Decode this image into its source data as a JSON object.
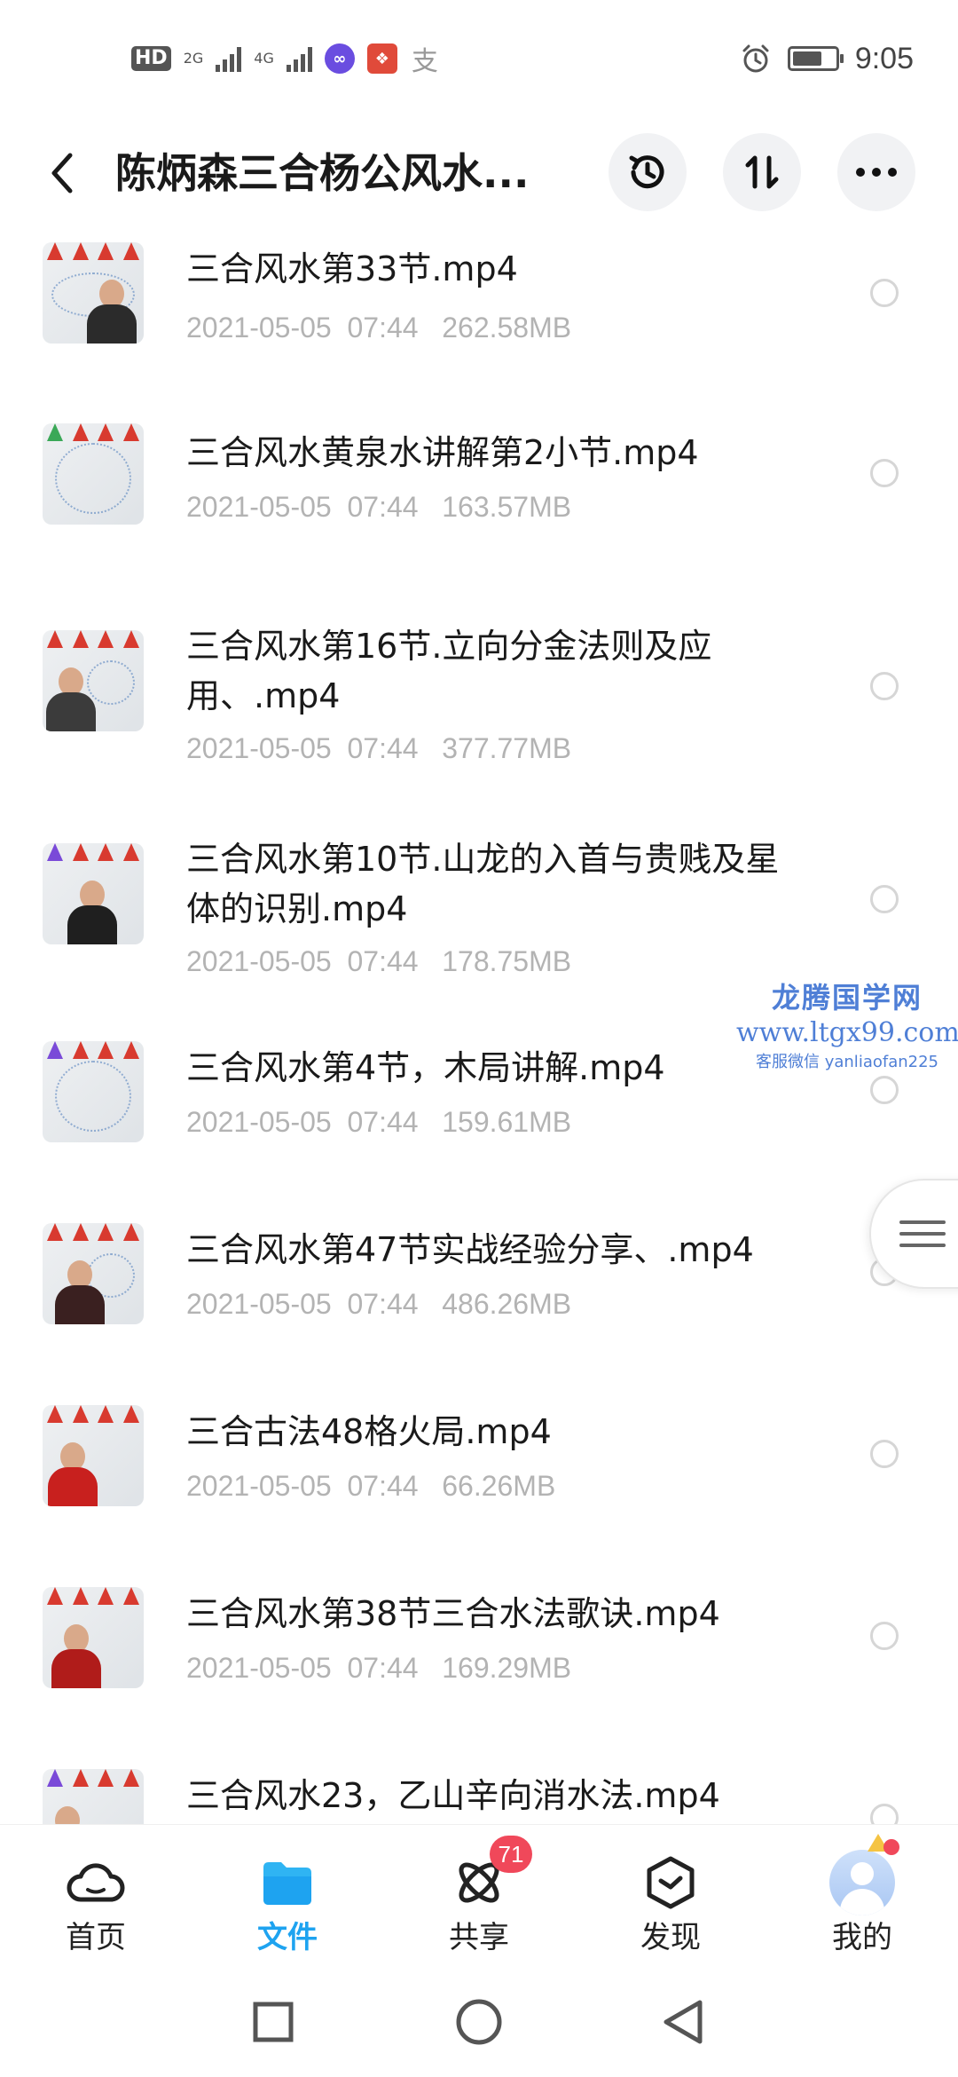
{
  "status_bar": {
    "hd_label": "HD",
    "network_labels": [
      "2G",
      "4G"
    ],
    "apps": [
      {
        "icon": "infinity-app-icon",
        "color": "#6a4de0"
      },
      {
        "icon": "red-app-icon",
        "color": "#e04a3a"
      },
      {
        "icon": "alipay-icon",
        "color": "#999999",
        "glyph": "支"
      }
    ],
    "time": "9:05",
    "battery_level": 0.7
  },
  "header": {
    "title": "陈炳森三合杨公风水...",
    "back_icon": "chevron-left-icon",
    "actions": [
      "history-icon",
      "sort-icon",
      "more-icon"
    ]
  },
  "files": [
    {
      "name": "三合风水第33节.mp4",
      "date": "2021-05-05  07:44",
      "size": "262.58MB",
      "thumb_body": "#2b2b2b"
    },
    {
      "name": "三合风水黄泉水讲解第2小节.mp4",
      "date": "2021-05-05  07:44",
      "size": "163.57MB",
      "thumb_body": "none"
    },
    {
      "name": "三合风水第16节.立向分金法则及应用、.mp4",
      "date": "2021-05-05  07:44",
      "size": "377.77MB",
      "thumb_body": "#3b3b3b"
    },
    {
      "name": "三合风水第10节.山龙的入首与贵贱及星体的识别.mp4",
      "date": "2021-05-05  07:44",
      "size": "178.75MB",
      "thumb_body": "#1f1f1f"
    },
    {
      "name": "三合风水第4节，木局讲解.mp4",
      "date": "2021-05-05  07:44",
      "size": "159.61MB",
      "thumb_body": "none"
    },
    {
      "name": "三合风水第47节实战经验分享、.mp4",
      "date": "2021-05-05  07:44",
      "size": "486.26MB",
      "thumb_body": "#3a2020"
    },
    {
      "name": "三合古法48格火局.mp4",
      "date": "2021-05-05  07:44",
      "size": "66.26MB",
      "thumb_body": "#c8201e"
    },
    {
      "name": "三合风水第38节三合水法歌诀.mp4",
      "date": "2021-05-05  07:44",
      "size": "169.29MB",
      "thumb_body": "#b01c1a"
    },
    {
      "name": "三合风水23，乙山辛向消水法.mp4",
      "date": "",
      "size": "",
      "thumb_body": "#2b2b2b"
    }
  ],
  "watermark": {
    "title": "龙腾国学网",
    "url": "www.ltgx99.com",
    "contact": "客服微信 yanliaofan225"
  },
  "bottom_nav": [
    {
      "label": "首页",
      "icon": "cloud-icon",
      "active": false
    },
    {
      "label": "文件",
      "icon": "folder-icon",
      "active": true
    },
    {
      "label": "共享",
      "icon": "share-atom-icon",
      "active": false,
      "badge": "71"
    },
    {
      "label": "发现",
      "icon": "discover-icon",
      "active": false
    },
    {
      "label": "我的",
      "icon": "avatar-icon",
      "active": false
    }
  ],
  "system_nav": [
    "recent-apps-icon",
    "home-icon",
    "back-icon"
  ],
  "colors": {
    "accent": "#1ea3f0",
    "badge": "#f0485a",
    "meta_text": "#b3b3b3",
    "watermark": "#4f7fd6"
  }
}
